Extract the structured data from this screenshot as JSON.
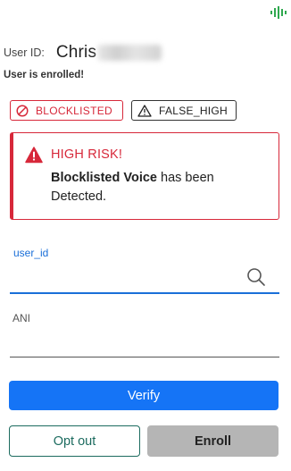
{
  "header": {
    "brand_icon": "sound-wave-icon",
    "brand_color": "#2fa84f"
  },
  "user": {
    "id_label": "User ID:",
    "id_name_visible": "Chris"
  },
  "status": {
    "enrolled_text": "User is enrolled!"
  },
  "badges": [
    {
      "label": "BLOCKLISTED",
      "icon": "prohibited-icon",
      "color": "#d7283a"
    },
    {
      "label": "FALSE_HIGH",
      "icon": "warning-icon",
      "color": "#222222"
    }
  ],
  "alert": {
    "icon": "warning-icon",
    "title": "HIGH RISK!",
    "body_bold": "Blocklisted Voice",
    "body_rest": " has been Detected.",
    "color": "#d7283a"
  },
  "form": {
    "user_id": {
      "label": "user_id",
      "value": "",
      "placeholder": ""
    },
    "ani": {
      "label": "ANI",
      "value": "",
      "placeholder": ""
    }
  },
  "actions": {
    "verify_label": "Verify",
    "opt_out_label": "Opt out",
    "enroll_label": "Enroll"
  },
  "colors": {
    "primary": "#1574f6",
    "danger": "#d7283a",
    "secondary": "#1c6b5f",
    "disabled": "#b5b5b5",
    "link": "#1a6fd8"
  }
}
